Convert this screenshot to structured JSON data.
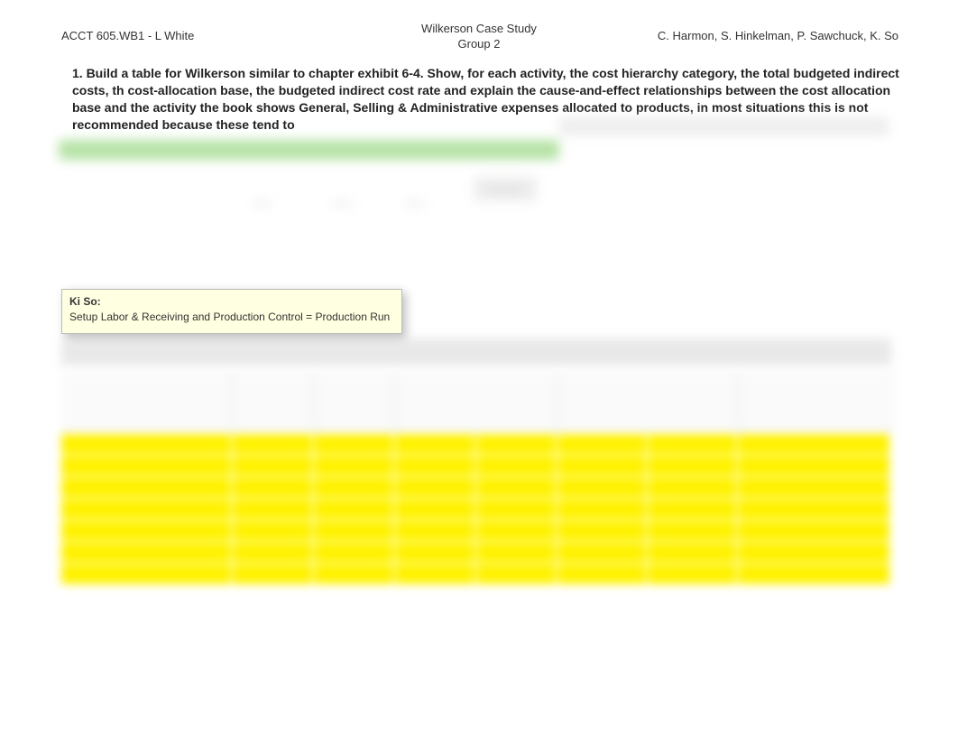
{
  "header": {
    "left": "ACCT 605.WB1 - L White",
    "center_line1": "Wilkerson Case Study",
    "center_line2": "Group 2",
    "right": "C. Harmon, S. Hinkelman, P. Sawchuck, K. So"
  },
  "question": {
    "text": "1.    Build a table for Wilkerson similar to chapter exhibit 6-4. Show, for each activity, the cost hierarchy category, the total budgeted indirect costs, th cost-allocation base, the budgeted indirect cost rate and explain the cause-and-effect relationships between the cost allocation base and the activity the book shows General, Selling & Administrative expenses allocated to products, in most situations this is not recommended because these tend to"
  },
  "comment": {
    "author": "Ki So:",
    "text": "Setup Labor & Receiving and Production Control = Production Run"
  },
  "blurred_labels": {
    "l1": "——",
    "l2": "——",
    "l3": "——",
    "l4": "————"
  },
  "yellow_table": {
    "row_count": 7,
    "col_widths": [
      "190",
      "90",
      "90",
      "90",
      "90",
      "100",
      "100",
      "170"
    ]
  }
}
